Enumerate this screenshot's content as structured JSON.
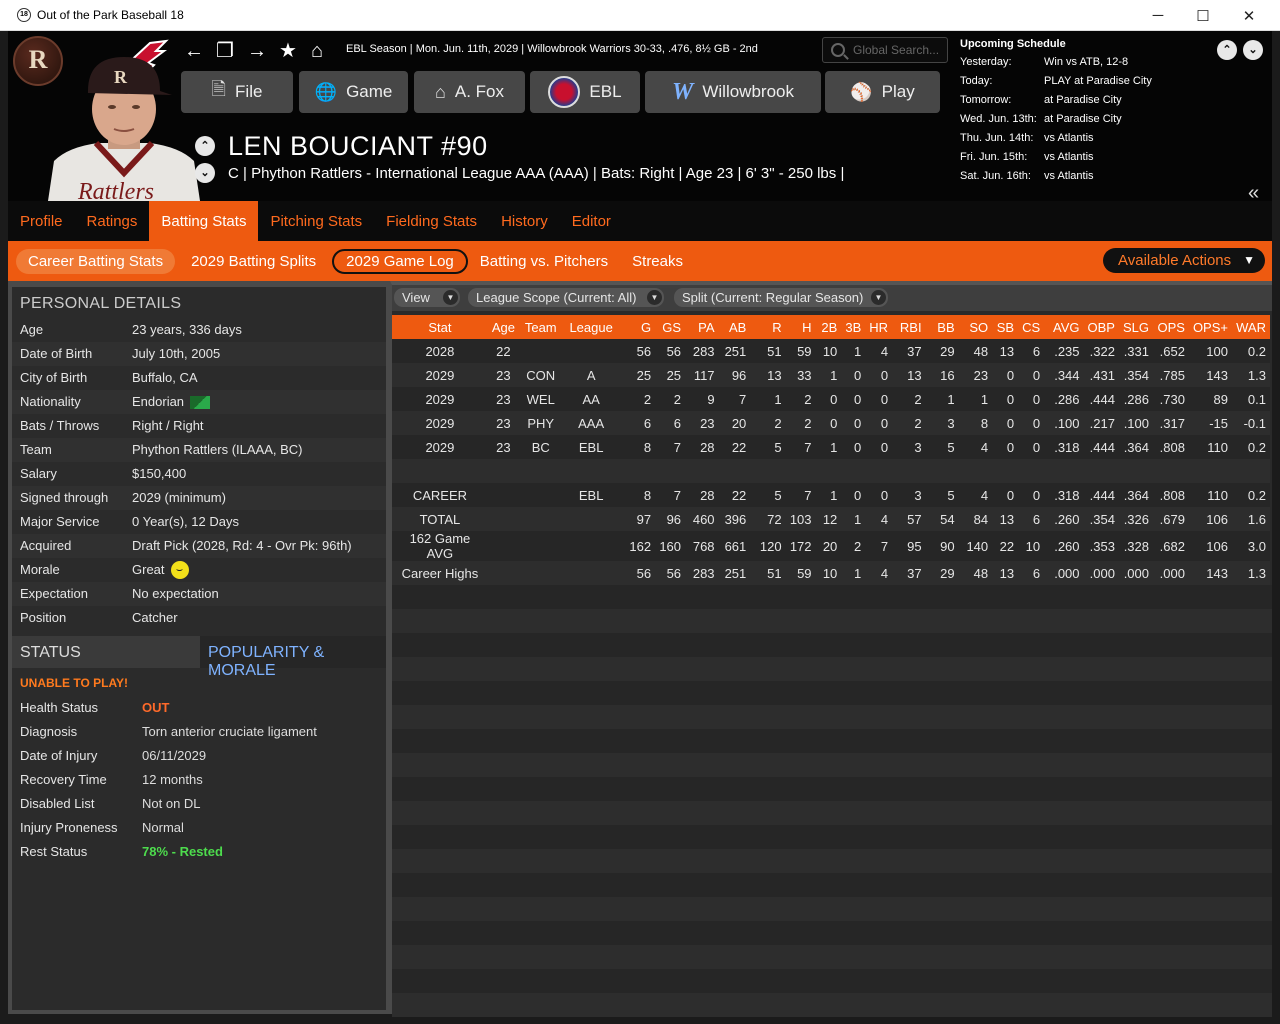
{
  "window": {
    "title": "Out of the Park Baseball 18",
    "app_icon_text": "18",
    "minimize": "─",
    "maximize": "☐",
    "close": "✕"
  },
  "header": {
    "season_bar": "EBL Season  |  Mon. Jun. 11th, 2029  |  Willowbrook Warriors  30-33, .476, 8½ GB - 2nd",
    "search_placeholder": "Global Search...",
    "nav_buttons": [
      {
        "label": "File",
        "icon": "file-icon"
      },
      {
        "label": "Game",
        "icon": "globe-icon"
      },
      {
        "label": "A. Fox",
        "icon": "home-icon"
      },
      {
        "label": "EBL",
        "icon": "ebl-logo-icon"
      },
      {
        "label": "Willowbrook",
        "icon": "willowbrook-logo-icon"
      },
      {
        "label": "Play",
        "icon": "baseball-icon"
      }
    ],
    "player_name": "LEN BOUCIANT  #90",
    "player_info": "C | Phython Rattlers - International League AAA (AAA)  |  Bats: Right  |  Age 23  |  6' 3\" - 250 lbs  |",
    "team_logo_letter": "R"
  },
  "schedule": {
    "title": "Upcoming Schedule",
    "rows": [
      {
        "day": "Yesterday:",
        "game": "Win vs ATB, 12-8"
      },
      {
        "day": "Today:",
        "game": "PLAY at Paradise City"
      },
      {
        "day": "Tomorrow:",
        "game": "at Paradise City"
      },
      {
        "day": "Wed. Jun. 13th:",
        "game": "at Paradise City"
      },
      {
        "day": "Thu. Jun. 14th:",
        "game": "vs Atlantis"
      },
      {
        "day": "Fri. Jun. 15th:",
        "game": "vs Atlantis"
      },
      {
        "day": "Sat. Jun. 16th:",
        "game": "vs Atlantis"
      }
    ]
  },
  "tabs": [
    "Profile",
    "Ratings",
    "Batting Stats",
    "Pitching Stats",
    "Fielding Stats",
    "History",
    "Editor"
  ],
  "subtabs": [
    "Career Batting Stats",
    "2029 Batting Splits",
    "2029 Game Log",
    "Batting vs. Pitchers",
    "Streaks"
  ],
  "available_actions": "Available Actions",
  "personal": {
    "title": "PERSONAL DETAILS",
    "rows": [
      {
        "k": "Age",
        "v": "23 years, 336 days"
      },
      {
        "k": "Date of Birth",
        "v": "July 10th, 2005"
      },
      {
        "k": "City of Birth",
        "v": "Buffalo, CA"
      },
      {
        "k": "Nationality",
        "v": "Endorian"
      },
      {
        "k": "Bats / Throws",
        "v": "Right / Right"
      },
      {
        "k": "Team",
        "v": "Phython Rattlers (ILAAA, BC)"
      },
      {
        "k": "Salary",
        "v": "$150,400"
      },
      {
        "k": "Signed through",
        "v": "2029 (minimum)"
      },
      {
        "k": "Major Service",
        "v": "0 Year(s), 12 Days"
      },
      {
        "k": "Acquired",
        "v": "Draft Pick (2028, Rd: 4 - Ovr Pk: 96th)"
      },
      {
        "k": "Morale",
        "v": "Great"
      },
      {
        "k": "Expectation",
        "v": "No expectation"
      },
      {
        "k": "Position",
        "v": "Catcher"
      }
    ]
  },
  "status": {
    "tab_status": "STATUS",
    "tab_popularity": "POPULARITY & MORALE",
    "warning": "UNABLE TO PLAY!",
    "rows": [
      {
        "k": "Health Status",
        "v": "OUT"
      },
      {
        "k": "Diagnosis",
        "v": "Torn anterior cruciate ligament"
      },
      {
        "k": "Date of Injury",
        "v": "06/11/2029"
      },
      {
        "k": "Recovery Time",
        "v": "12 months"
      },
      {
        "k": "Disabled List",
        "v": "Not on DL"
      },
      {
        "k": "Injury Proneness",
        "v": "Normal"
      },
      {
        "k": "Rest Status",
        "v": "78% - Rested"
      }
    ]
  },
  "filters": {
    "view": "View",
    "league_scope": "League Scope  (Current: All)",
    "split": "Split  (Current: Regular Season)"
  },
  "stats_table": {
    "columns": [
      "Stat",
      "Age",
      "Team",
      "League",
      "G",
      "GS",
      "PA",
      "AB",
      "R",
      "H",
      "2B",
      "3B",
      "HR",
      "RBI",
      "BB",
      "SO",
      "SB",
      "CS",
      "AVG",
      "OBP",
      "SLG",
      "OPS",
      "OPS+",
      "WAR"
    ],
    "rows": [
      [
        "2028",
        "22",
        "",
        "",
        "56",
        "56",
        "283",
        "251",
        "51",
        "59",
        "10",
        "1",
        "4",
        "37",
        "29",
        "48",
        "13",
        "6",
        ".235",
        ".322",
        ".331",
        ".652",
        "100",
        "0.2"
      ],
      [
        "2029",
        "23",
        "CON",
        "A",
        "25",
        "25",
        "117",
        "96",
        "13",
        "33",
        "1",
        "0",
        "0",
        "13",
        "16",
        "23",
        "0",
        "0",
        ".344",
        ".431",
        ".354",
        ".785",
        "143",
        "1.3"
      ],
      [
        "2029",
        "23",
        "WEL",
        "AA",
        "2",
        "2",
        "9",
        "7",
        "1",
        "2",
        "0",
        "0",
        "0",
        "2",
        "1",
        "1",
        "0",
        "0",
        ".286",
        ".444",
        ".286",
        ".730",
        "89",
        "0.1"
      ],
      [
        "2029",
        "23",
        "PHY",
        "AAA",
        "6",
        "6",
        "23",
        "20",
        "2",
        "2",
        "0",
        "0",
        "0",
        "2",
        "3",
        "8",
        "0",
        "0",
        ".100",
        ".217",
        ".100",
        ".317",
        "-15",
        "-0.1"
      ],
      [
        "2029",
        "23",
        "BC",
        "EBL",
        "8",
        "7",
        "28",
        "22",
        "5",
        "7",
        "1",
        "0",
        "0",
        "3",
        "5",
        "4",
        "0",
        "0",
        ".318",
        ".444",
        ".364",
        ".808",
        "110",
        "0.2"
      ],
      [
        "",
        "",
        "",
        "",
        "",
        "",
        "",
        "",
        "",
        "",
        "",
        "",
        "",
        "",
        "",
        "",
        "",
        "",
        "",
        "",
        "",
        "",
        "",
        ""
      ],
      [
        "CAREER",
        "",
        "",
        "EBL",
        "8",
        "7",
        "28",
        "22",
        "5",
        "7",
        "1",
        "0",
        "0",
        "3",
        "5",
        "4",
        "0",
        "0",
        ".318",
        ".444",
        ".364",
        ".808",
        "110",
        "0.2"
      ],
      [
        "TOTAL",
        "",
        "",
        "",
        "97",
        "96",
        "460",
        "396",
        "72",
        "103",
        "12",
        "1",
        "4",
        "57",
        "54",
        "84",
        "13",
        "6",
        ".260",
        ".354",
        ".326",
        ".679",
        "106",
        "1.6"
      ],
      [
        "162 Game AVG",
        "",
        "",
        "",
        "162",
        "160",
        "768",
        "661",
        "120",
        "172",
        "20",
        "2",
        "7",
        "95",
        "90",
        "140",
        "22",
        "10",
        ".260",
        ".353",
        ".328",
        ".682",
        "106",
        "3.0"
      ],
      [
        "Career Highs",
        "",
        "",
        "",
        "56",
        "56",
        "283",
        "251",
        "51",
        "59",
        "10",
        "1",
        "4",
        "37",
        "29",
        "48",
        "13",
        "6",
        ".000",
        ".000",
        ".000",
        ".000",
        "143",
        "1.3"
      ]
    ]
  }
}
